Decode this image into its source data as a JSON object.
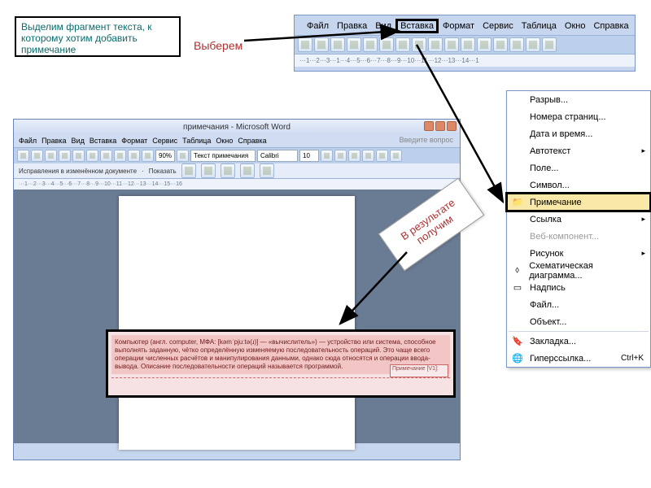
{
  "annotation": {
    "note_text": "Выделим фрагмент текста, к которому хотим добавить примечание",
    "select_label": "Выберем",
    "result_label": "В результате получим"
  },
  "menubar": {
    "items": [
      "Файл",
      "Правка",
      "Вид",
      "Вставка",
      "Формат",
      "Сервис",
      "Таблица",
      "Окно",
      "Справка"
    ],
    "highlighted": "Вставка",
    "ruler_text": "···1···2···3···1···4···5···6···7···8···9···10···11···12···13···14···1"
  },
  "dropdown": {
    "items": [
      {
        "label": "Разрыв...",
        "icon": ""
      },
      {
        "label": "Номера страниц...",
        "icon": ""
      },
      {
        "label": "Дата и время...",
        "icon": ""
      },
      {
        "label": "Автотекст",
        "icon": "",
        "submenu": true
      },
      {
        "label": "Поле...",
        "icon": ""
      },
      {
        "label": "Символ...",
        "icon": ""
      },
      {
        "label": "Примечание",
        "icon": "folder",
        "highlight": true
      },
      {
        "label": "Ссылка",
        "icon": "",
        "submenu": true
      },
      {
        "label": "Веб-компонент...",
        "icon": "",
        "disabled": true
      },
      {
        "label": "Рисунок",
        "icon": "",
        "submenu": true
      },
      {
        "label": "Схематическая диаграмма...",
        "icon": "diagram"
      },
      {
        "label": "Надпись",
        "icon": "textbox"
      },
      {
        "label": "Файл...",
        "icon": ""
      },
      {
        "label": "Объект...",
        "icon": ""
      },
      {
        "label": "Закладка...",
        "icon": "bookmark"
      },
      {
        "label": "Гиперссылка...",
        "icon": "globe",
        "shortcut": "Ctrl+K"
      }
    ]
  },
  "word2": {
    "title": "примечания - Microsoft Word",
    "menus": [
      "Файл",
      "Правка",
      "Вид",
      "Вставка",
      "Формат",
      "Сервис",
      "Таблица",
      "Окно",
      "Справка"
    ],
    "question": "Введите вопрос",
    "combo_zoom": "90%",
    "combo_style": "Текст примечания",
    "combo_font": "Calibri",
    "combo_size": "10",
    "track_label": "Исправления в изменённом документе",
    "show_label": "Показать",
    "ruler": "···1···2···3···4···5···6···7···8···9···10···11···12···13···14···15···16"
  },
  "paragraph": {
    "body": "Компьютер (англ. computer, МФА: [kəmˈpjuːtə(ɹ)] — «вычислитель») — устройство или система, способное выполнять заданную, чётко определённую изменяемую последовательность операций. Это чаще всего операции численных расчётов и манипулирования данными, однако сюда относятся и операции ввода-вывода. Описание последовательности операций называется программой.",
    "comment_label": "Примечание [V1]:"
  }
}
